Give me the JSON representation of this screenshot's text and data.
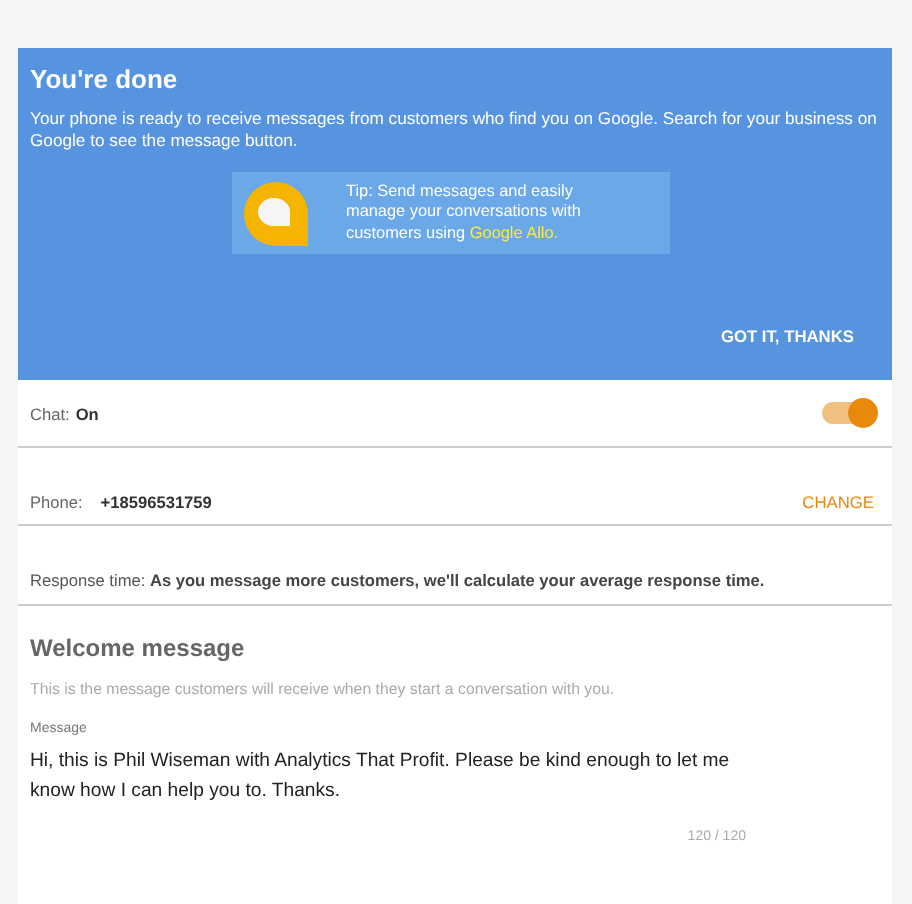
{
  "banner": {
    "title": "You're done",
    "text": "Your phone is ready to receive messages from customers who find you on Google. Search for your business on Google to see the message button.",
    "tip": {
      "text": "Tip: Send messages and easily manage your conversations with customers using ",
      "link": "Google Allo."
    },
    "button": "GOT IT, THANKS"
  },
  "chat": {
    "label": "Chat:",
    "value": "On",
    "on": true
  },
  "phone": {
    "label": "Phone:",
    "value": "+18596531759",
    "action": "CHANGE"
  },
  "response": {
    "text": "Response time: **As you message more customers, we'll calculate your average response time.**"
  },
  "welcome": {
    "title": "Welcome message",
    "description": "This is the message customers will receive when they start a conversation with you.",
    "field_label": "Message",
    "value": "Hi, this is Phil Wiseman with Analytics That Profit. Please be kind enough to let me know how I can help you to. Thanks.",
    "counter": "120 / 120"
  }
}
